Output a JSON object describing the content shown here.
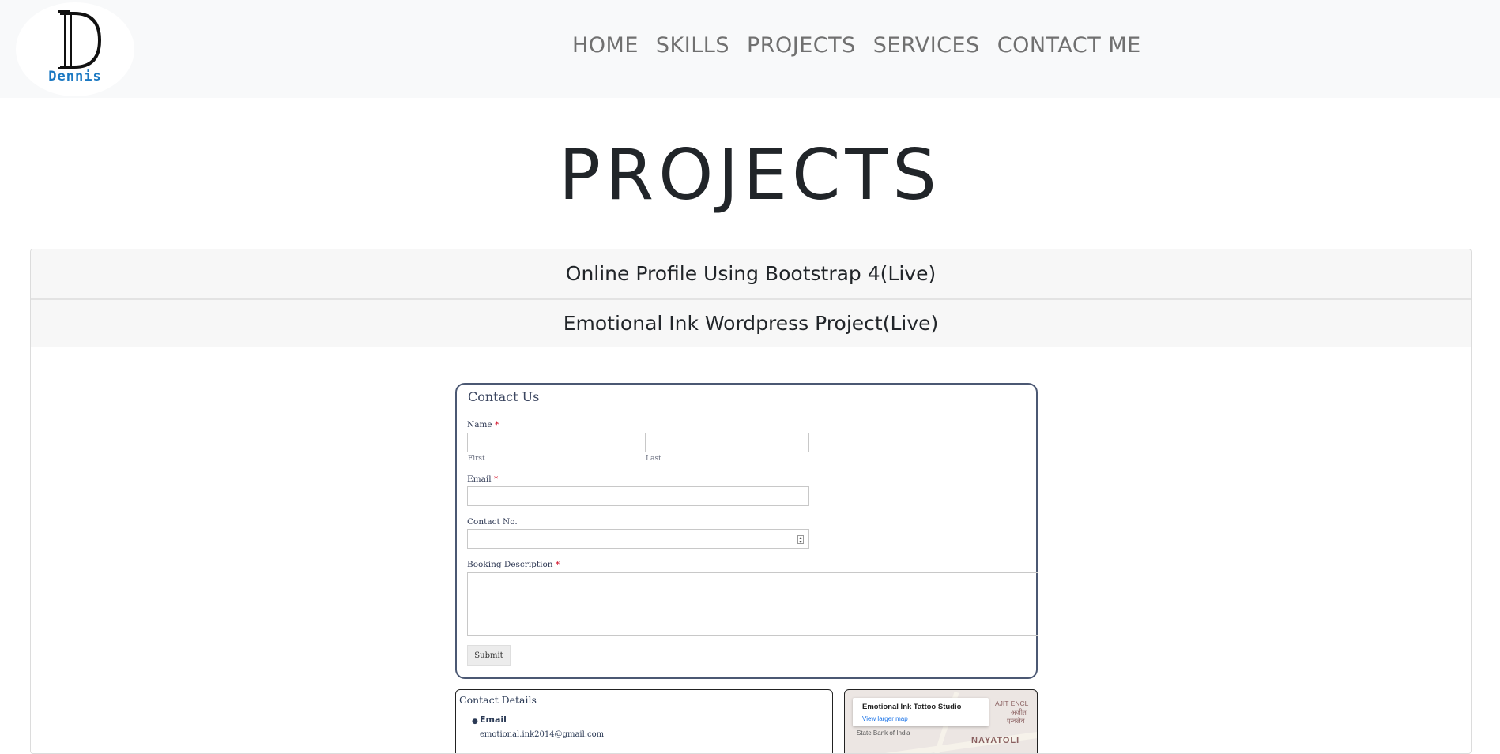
{
  "navbar": {
    "logo_name": "Dennis",
    "links": [
      "HOME",
      "SKILLS",
      "PROJECTS",
      "SERVICES",
      "CONTACT ME"
    ]
  },
  "page": {
    "title": "PROJECTS"
  },
  "accordion": {
    "items": [
      {
        "label": "Online Profile Using Bootstrap 4(Live)"
      },
      {
        "label": "Emotional Ink Wordpress Project(Live)"
      }
    ]
  },
  "contact_form": {
    "title": "Contact Us",
    "name_label": "Name",
    "first_sub": "First",
    "last_sub": "Last",
    "email_label": "Email",
    "contact_label": "Contact No.",
    "booking_label": "Booking Description",
    "required_mark": "*",
    "submit_label": "Submit"
  },
  "contact_details": {
    "title": "Contact Details",
    "email_label": "Email",
    "email_value": "emotional.ink2014@gmail.com"
  },
  "map": {
    "place_name": "Emotional Ink Tattoo Studio",
    "link": "View larger map",
    "labels": [
      "AJIT ENCL",
      "अजीत",
      "एन्क्लेव",
      "State Bank of India",
      "NAYATOLI"
    ]
  },
  "colors": {
    "navbar_bg": "#f8f9fa",
    "nav_link": "#707070",
    "logo_text": "#1a78c2",
    "form_border": "#4b5873",
    "required": "#d0021b"
  }
}
